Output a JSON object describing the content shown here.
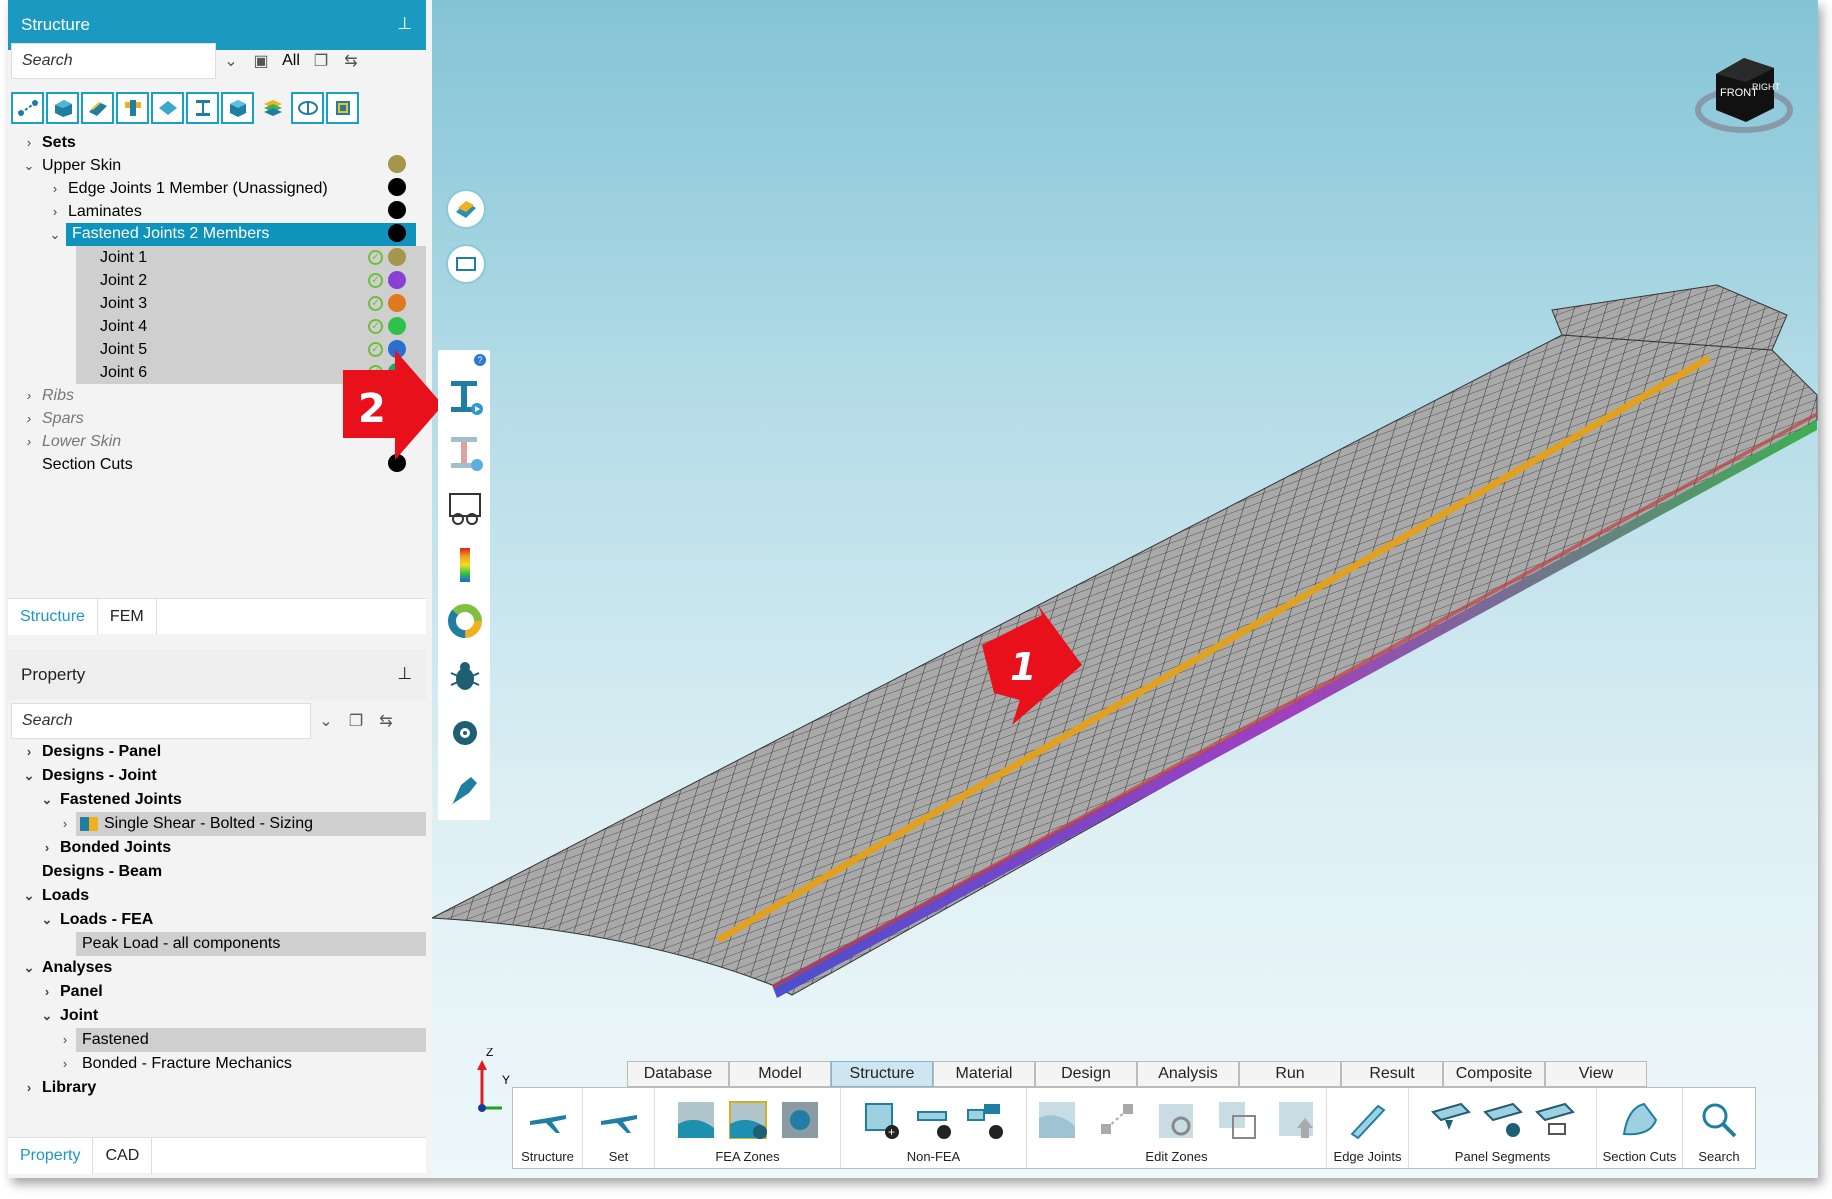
{
  "structure_panel": {
    "title": "Structure",
    "search_placeholder": "Search",
    "filter_all": "All",
    "tree": [
      {
        "label": "Sets"
      },
      {
        "label": "Upper Skin"
      },
      {
        "label": "Edge Joints 1 Member (Unassigned)"
      },
      {
        "label": "Laminates"
      },
      {
        "label": "Fastened Joints 2 Members"
      },
      {
        "label": "Joint 1"
      },
      {
        "label": "Joint 2"
      },
      {
        "label": "Joint 3"
      },
      {
        "label": "Joint 4"
      },
      {
        "label": "Joint 5"
      },
      {
        "label": "Joint 6"
      },
      {
        "label": "Ribs"
      },
      {
        "label": "Spars"
      },
      {
        "label": "Lower Skin"
      },
      {
        "label": "Section Cuts"
      }
    ],
    "tabs": [
      "Structure",
      "FEM"
    ]
  },
  "property_panel": {
    "title": "Property",
    "search_placeholder": "Search",
    "tree": [
      {
        "label": "Designs - Panel"
      },
      {
        "label": "Designs - Joint"
      },
      {
        "label": "Fastened Joints"
      },
      {
        "label": "Single Shear - Bolted - Sizing"
      },
      {
        "label": "Bonded Joints"
      },
      {
        "label": "Designs - Beam"
      },
      {
        "label": "Loads"
      },
      {
        "label": "Loads - FEA"
      },
      {
        "label": "Peak Load - all components"
      },
      {
        "label": "Analyses"
      },
      {
        "label": "Panel"
      },
      {
        "label": "Joint"
      },
      {
        "label": "Fastened"
      },
      {
        "label": "Bonded - Fracture Mechanics"
      },
      {
        "label": "Library"
      }
    ],
    "tabs": [
      "Property",
      "CAD"
    ]
  },
  "colors": {
    "accent": "#1a9ac0",
    "joint_dots": [
      "#a4964a",
      "#8a3fd6",
      "#e0781e",
      "#2fc24a",
      "#2a6fcf",
      "#1aaa6a"
    ],
    "callout_red": "#e8101a"
  },
  "callouts": {
    "one": "1",
    "two": "2"
  },
  "view_cube": {
    "front": "FRONT",
    "right": "RIGHT",
    "axis_y": "Y",
    "axis_z": "Z"
  },
  "ribbon": {
    "tabs": [
      "Database",
      "Model",
      "Structure",
      "Material",
      "Design",
      "Analysis",
      "Run",
      "Result",
      "Composite",
      "View"
    ],
    "active_tab": "Structure",
    "groups": [
      "Structure",
      "Set",
      "FEA Zones",
      "Non-FEA",
      "Edit Zones",
      "Edge Joints",
      "Panel Segments",
      "Section Cuts",
      "Search"
    ]
  },
  "icons": {
    "side_tools": [
      "layers-icon",
      "rectangle-icon",
      "ibeam-run-icon",
      "ibeam-check-icon",
      "glasses-icon",
      "color-scale-icon",
      "donut-chart-icon",
      "bug-icon",
      "gear-eye-icon",
      "pen-icon"
    ]
  }
}
